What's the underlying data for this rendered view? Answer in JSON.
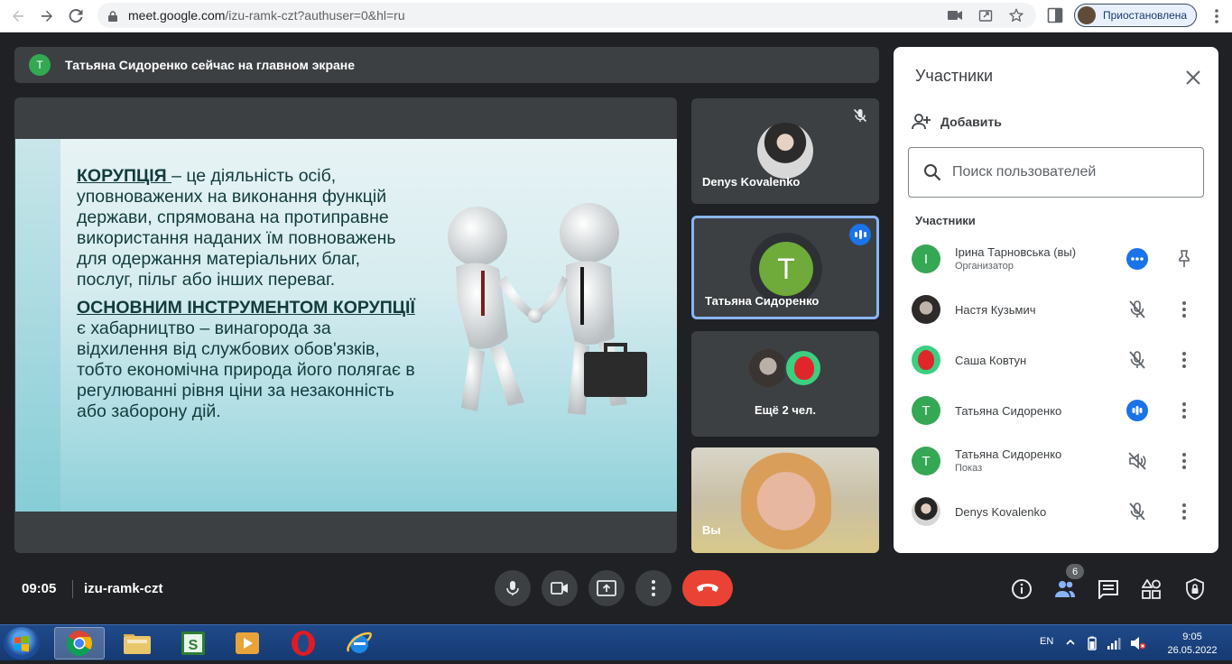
{
  "browser": {
    "url_host": "meet.google.com",
    "url_path": "/izu-ramk-czt?authuser=0&hl=ru",
    "profile_label": "Приостановлена"
  },
  "banner": {
    "avatar_letter": "T",
    "text": "Татьяна Сидоренко сейчас на главном экране"
  },
  "slide": {
    "p1_term": "КОРУПЦІЯ ",
    "p1_text": "– це діяльність осіб, уповноважених на виконання функцій держави, спрямована на протиправне використання наданих їм повноважень для одержання матеріальних благ, послуг, пільг або інших переваг.",
    "p2_term": "ОСНОВНИМ ІНСТРУМЕНТОМ КОРУПЦІЇ ",
    "p2_text": "є хабарництво – винагорода за відхилення від службових обов'язків, тобто економічна природа його полягає в регулюванні рівня ціни за незаконність або заборону дій."
  },
  "tiles": [
    {
      "name": "Denys Kovalenko"
    },
    {
      "name": "Татьяна Сидоренко",
      "avatar_letter": "T"
    },
    {
      "name": "Ещё 2 чел."
    },
    {
      "name": "Вы"
    }
  ],
  "panel": {
    "title": "Участники",
    "add_label": "Добавить",
    "search_placeholder": "Поиск пользователей",
    "section_label": "Участники",
    "participants": [
      {
        "name": "Ірина Тарновська (вы)",
        "subtitle": "Организатор"
      },
      {
        "name": "Настя Кузьмич"
      },
      {
        "name": "Саша Ковтун"
      },
      {
        "name": "Татьяна Сидоренко",
        "avatar_letter": "T"
      },
      {
        "name": "Татьяна Сидоренко",
        "subtitle": "Показ",
        "avatar_letter": "T"
      },
      {
        "name": "Denys Kovalenko"
      }
    ],
    "first_avatar_letter": "I"
  },
  "footer": {
    "time": "09:05",
    "meeting_code": "izu-ramk-czt",
    "participants_count": "6"
  },
  "taskbar": {
    "lang": "EN",
    "clock_time": "9:05",
    "clock_date": "26.05.2022"
  },
  "colors": {
    "accent_blue": "#1a73e8",
    "end_call_red": "#ea4335",
    "avatar_green": "#34a853"
  }
}
